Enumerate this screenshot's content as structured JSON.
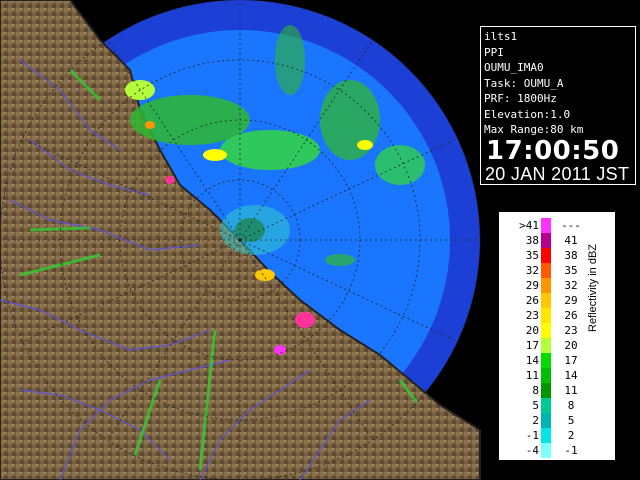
{
  "info": {
    "lines": [
      "ilts1",
      "PPI",
      "OUMU_IMA0",
      "Task: OUMU_A",
      "PRF: 1800Hz",
      "Elevation:1.0",
      "Max Range:80 km"
    ],
    "time": "17:00:50",
    "date": "20 JAN 2011 JST"
  },
  "legend": {
    "title": "Reflectivity in dBZ",
    "rows": [
      {
        "lo": ">41",
        "hi": "---",
        "color": "#ff33ff"
      },
      {
        "lo": "38",
        "hi": "41",
        "color": "#b4008c"
      },
      {
        "lo": "35",
        "hi": "38",
        "color": "#ff0000"
      },
      {
        "lo": "32",
        "hi": "35",
        "color": "#ff5a00"
      },
      {
        "lo": "29",
        "hi": "32",
        "color": "#ff9600"
      },
      {
        "lo": "26",
        "hi": "29",
        "color": "#ffc800"
      },
      {
        "lo": "23",
        "hi": "26",
        "color": "#ffe600"
      },
      {
        "lo": "20",
        "hi": "23",
        "color": "#ffff00"
      },
      {
        "lo": "17",
        "hi": "20",
        "color": "#b4ff3c"
      },
      {
        "lo": "14",
        "hi": "17",
        "color": "#00dc00"
      },
      {
        "lo": "11",
        "hi": "14",
        "color": "#00be00"
      },
      {
        "lo": "8",
        "hi": "11",
        "color": "#009600"
      },
      {
        "lo": "5",
        "hi": "8",
        "color": "#00c896"
      },
      {
        "lo": "2",
        "hi": "5",
        "color": "#00b4b4"
      },
      {
        "lo": "-1",
        "hi": "2",
        "color": "#00e6e6"
      },
      {
        "lo": "-4",
        "hi": "-1",
        "color": "#80ffff"
      }
    ]
  },
  "colors": {
    "sea_outer": "#1c3fd6",
    "sea_inner": "#1a75ff",
    "land": "#7a6240",
    "river": "#5a55d8",
    "echo_strong": "#33dd33",
    "echo_weak": "#33cccc"
  }
}
